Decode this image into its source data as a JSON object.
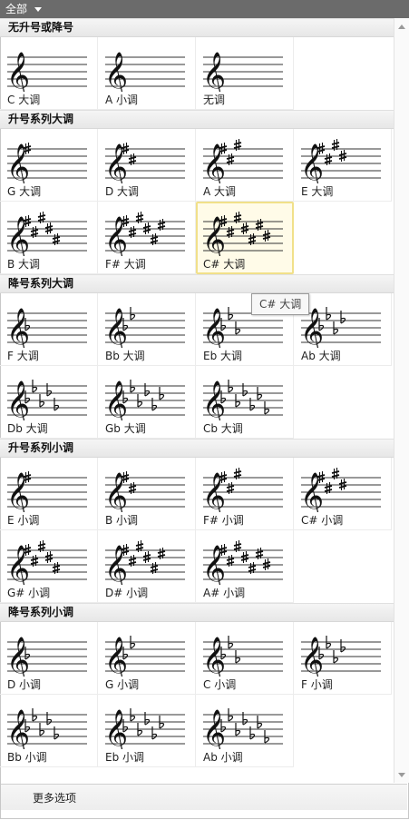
{
  "header": {
    "title": "全部"
  },
  "tooltip": {
    "text": "C# 大调"
  },
  "footer": {
    "more_label": "更多选项"
  },
  "sections": [
    {
      "title": "无升号或降号",
      "items": [
        {
          "label": "C 大调",
          "type": "none",
          "count": 0
        },
        {
          "label": "A 小调",
          "type": "none",
          "count": 0
        },
        {
          "label": "无调",
          "type": "none",
          "count": 0
        }
      ]
    },
    {
      "title": "升号系列大调",
      "items": [
        {
          "label": "G 大调",
          "type": "sharp",
          "count": 1
        },
        {
          "label": "D 大调",
          "type": "sharp",
          "count": 2
        },
        {
          "label": "A 大调",
          "type": "sharp",
          "count": 3
        },
        {
          "label": "E 大调",
          "type": "sharp",
          "count": 4
        },
        {
          "label": "B 大调",
          "type": "sharp",
          "count": 5
        },
        {
          "label": "F# 大调",
          "type": "sharp",
          "count": 6
        },
        {
          "label": "C# 大调",
          "type": "sharp",
          "count": 7,
          "selected": true
        }
      ]
    },
    {
      "title": "降号系列大调",
      "items": [
        {
          "label": "F 大调",
          "type": "flat",
          "count": 1
        },
        {
          "label": "Bb 大调",
          "type": "flat",
          "count": 2
        },
        {
          "label": "Eb 大调",
          "type": "flat",
          "count": 3
        },
        {
          "label": "Ab 大调",
          "type": "flat",
          "count": 4
        },
        {
          "label": "Db 大调",
          "type": "flat",
          "count": 5
        },
        {
          "label": "Gb 大调",
          "type": "flat",
          "count": 6
        },
        {
          "label": "Cb 大调",
          "type": "flat",
          "count": 7
        }
      ]
    },
    {
      "title": "升号系列小调",
      "items": [
        {
          "label": "E 小调",
          "type": "sharp",
          "count": 1
        },
        {
          "label": "B 小调",
          "type": "sharp",
          "count": 2
        },
        {
          "label": "F# 小调",
          "type": "sharp",
          "count": 3
        },
        {
          "label": "C# 小调",
          "type": "sharp",
          "count": 4
        },
        {
          "label": "G# 小调",
          "type": "sharp",
          "count": 5
        },
        {
          "label": "D# 小调",
          "type": "sharp",
          "count": 6
        },
        {
          "label": "A# 小调",
          "type": "sharp",
          "count": 7
        }
      ]
    },
    {
      "title": "降号系列小调",
      "items": [
        {
          "label": "D 小调",
          "type": "flat",
          "count": 1
        },
        {
          "label": "G 小调",
          "type": "flat",
          "count": 2
        },
        {
          "label": "C 小调",
          "type": "flat",
          "count": 3
        },
        {
          "label": "F 小调",
          "type": "flat",
          "count": 4
        },
        {
          "label": "Bb 小调",
          "type": "flat",
          "count": 5
        },
        {
          "label": "Eb 小调",
          "type": "flat",
          "count": 6
        },
        {
          "label": "Ab 小调",
          "type": "flat",
          "count": 7
        }
      ]
    }
  ]
}
